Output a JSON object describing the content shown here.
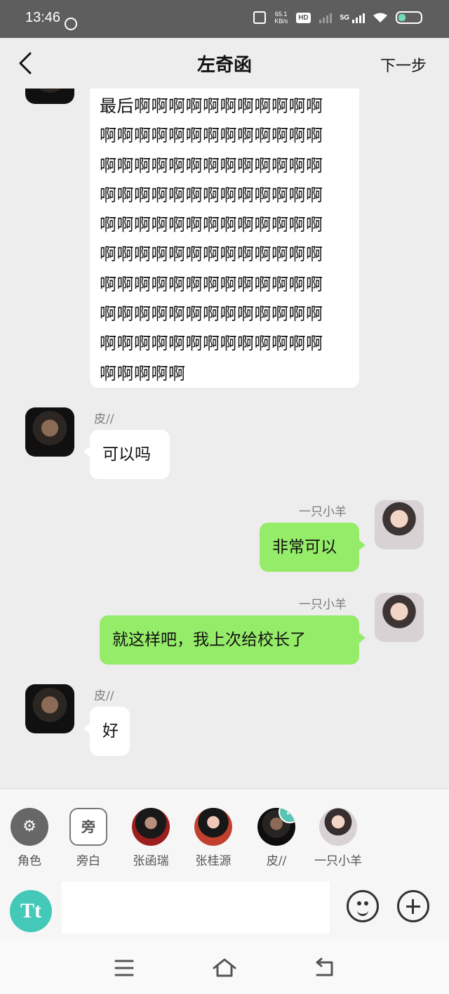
{
  "status_bar": {
    "time": "13:46",
    "net_speed_top": "65.1",
    "net_speed_bottom": "KB/s",
    "hd_label": "HD",
    "network_label": "5G"
  },
  "header": {
    "title": "左奇函",
    "next_label": "下一步"
  },
  "messages": [
    {
      "side": "left",
      "text": "最后啊啊啊啊啊啊啊啊啊啊啊啊啊啊啊啊啊啊啊啊啊啊啊啊啊啊啊啊啊啊啊啊啊啊啊啊啊啊啊啊啊啊啊啊啊啊啊啊啊啊啊啊啊啊啊啊啊啊啊啊啊啊啊啊啊啊啊啊啊啊啊啊啊啊啊啊啊啊啊啊啊啊啊啊啊啊啊啊啊啊啊啊啊啊啊啊啊啊啊啊啊啊啊啊啊啊啊啊啊啊啊啊啊啊啊啊啊啊啊啊"
    },
    {
      "side": "left",
      "name": "皮//",
      "text": "可以吗"
    },
    {
      "side": "right",
      "name": "一只小羊",
      "text": "非常可以"
    },
    {
      "side": "right",
      "name": "一只小羊",
      "text": "就这样吧，我上次给校长了"
    },
    {
      "side": "left",
      "name": "皮//",
      "text": "好"
    }
  ],
  "roles": [
    {
      "label": "角色",
      "icon": "user-settings-icon"
    },
    {
      "label": "旁白",
      "icon_text": "旁"
    },
    {
      "label": "张函瑞"
    },
    {
      "label": "张桂源"
    },
    {
      "label": "皮//",
      "selected": true
    },
    {
      "label": "一只小羊"
    }
  ],
  "composer": {
    "font_button_label": "Tt"
  }
}
